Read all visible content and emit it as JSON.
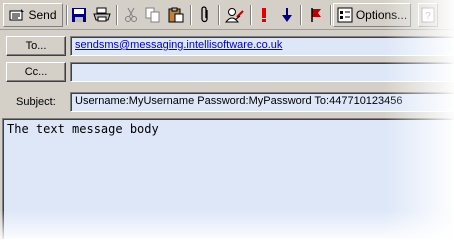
{
  "toolbar": {
    "send_label": "Send",
    "options_label": "Options...",
    "icons": [
      "send-icon",
      "save-icon",
      "print-icon",
      "cut-icon",
      "copy-icon",
      "paste-icon",
      "attach-icon",
      "address-book-icon",
      "high-importance-icon",
      "low-importance-icon",
      "flag-icon",
      "options-icon",
      "help-icon"
    ]
  },
  "header": {
    "to_button": "To...",
    "cc_button": "Cc...",
    "subject_label": "Subject:",
    "to_value": "sendsms@messaging.intellisoftware.co.uk",
    "cc_value": "",
    "subject_value": "Username:MyUsername Password:MyPassword To:447710123456"
  },
  "body": {
    "text": "The text message body"
  },
  "colors": {
    "field_bg": "#dde7f8",
    "chrome": "#d4d0c8",
    "link": "#0000cc"
  }
}
